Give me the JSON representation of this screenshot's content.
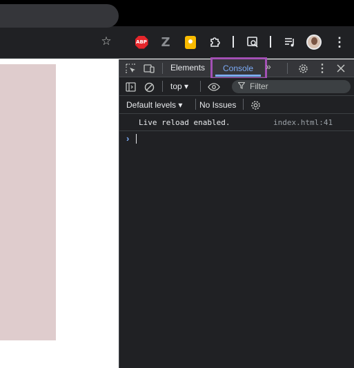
{
  "browser": {
    "new_tab_icon": "plus-icon",
    "toolbar": {
      "bookmark_icon": "star-icon",
      "extensions": [
        "adblock-plus-icon",
        "z-icon",
        "google-keep-icon",
        "puzzle-extensions-icon",
        "devtools-extension-icon",
        "media-control-icon"
      ],
      "abp_label": "ABP",
      "z_label": "Z",
      "profile_icon": "avatar",
      "menu_icon": "kebab-menu-icon"
    }
  },
  "page": {
    "block_color": "#dfcccd"
  },
  "devtools": {
    "tabs": {
      "elements": "Elements",
      "console": "Console",
      "more": "»"
    },
    "accent_color": "#7cacf8",
    "highlight_color": "#a350b5",
    "console": {
      "context": "top ▾",
      "filter_placeholder": "Filter",
      "levels": "Default levels ▾",
      "issues": "No Issues",
      "messages": [
        {
          "text": "Live reload enabled.",
          "source": "index.html:41"
        }
      ],
      "prompt": "›"
    }
  }
}
